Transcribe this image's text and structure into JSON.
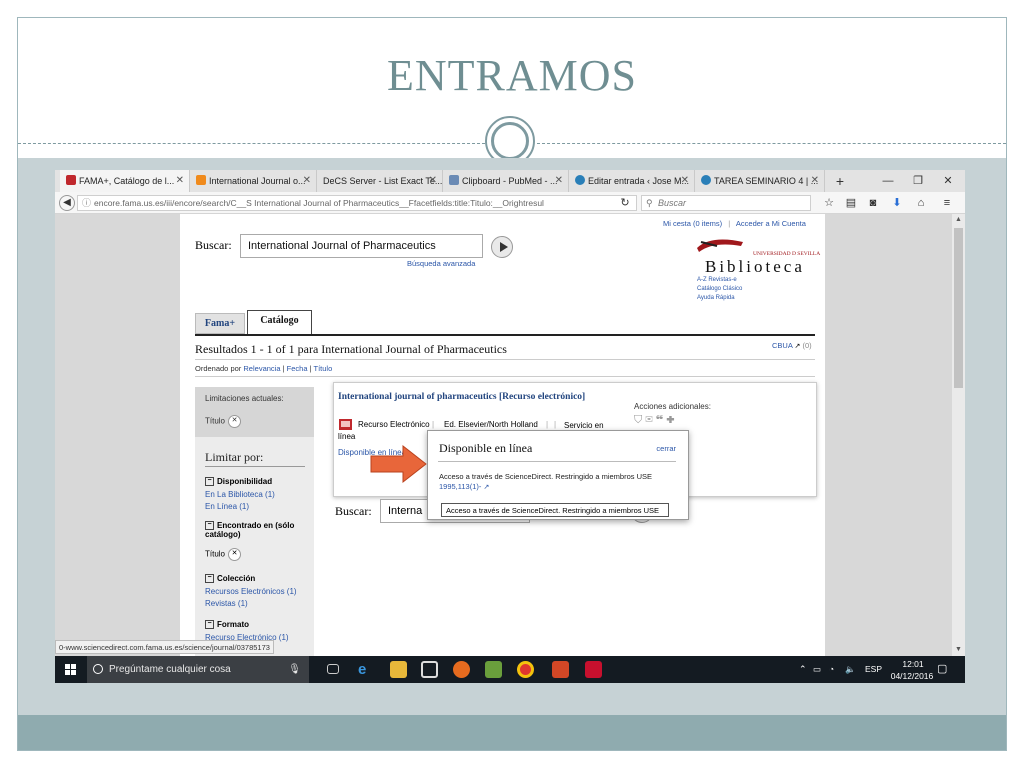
{
  "slide": {
    "title": "ENTRAMOS"
  },
  "browser": {
    "tabs": [
      {
        "label": "FAMA+, Catálogo de l...",
        "close": "✕"
      },
      {
        "label": "International Journal o...",
        "close": "✕"
      },
      {
        "label": "DeCS Server - List Exact Te...",
        "close": "✕"
      },
      {
        "label": "Clipboard - PubMed - ...",
        "close": "✕"
      },
      {
        "label": "Editar entrada ‹ Jose M...",
        "close": "✕"
      },
      {
        "label": "TAREA SEMINARIO 4 | ...",
        "close": "✕"
      }
    ],
    "new_tab": "+",
    "window": {
      "minimize": "—",
      "restore": "❐",
      "close": "✕"
    },
    "url": "encore.fama.us.es/iii/encore/search/C__S International Journal of Pharmaceutics__Ffacetfields:title:Titulo:__Orightresul",
    "search_placeholder": "Buscar",
    "status_url": "0-www.sciencedirect.com.fama.us.es/science/journal/03785173"
  },
  "page": {
    "account": {
      "cart": "Mi cesta (0 items)",
      "sep": "|",
      "login": "Acceder a Mi Cuenta"
    },
    "buscar_label": "Buscar:",
    "search_value": "International Journal of Pharmaceutics",
    "advanced": "Búsqueda avanzada",
    "logo": {
      "university": "UNIVERSIDAD D SEVILLA",
      "name": "Biblioteca",
      "links": [
        "A-Z Revistas-e",
        "Catálogo Clásico",
        "Ayuda Rápida"
      ]
    },
    "tabs": {
      "fama": "Fama+",
      "catalogo": "Catálogo"
    },
    "results_heading": "Resultados 1 - 1 of 1 para International Journal of Pharmaceutics",
    "cbua": "CBUA",
    "cbua_count": "(0)",
    "sort": {
      "label": "Ordenado por",
      "relevancia": "Relevancia",
      "fecha": "Fecha",
      "titulo": "Título",
      "sep": "|"
    },
    "facets": {
      "current_label": "Limitaciones actuales:",
      "current_chip": "Título",
      "limit_heading": "Limitar por:",
      "groups": [
        {
          "title": "Disponibilidad",
          "items": [
            "En La Biblioteca (1)",
            "En Línea (1)"
          ]
        },
        {
          "title": "Encontrado en (sólo catálogo)",
          "items": [
            "Título"
          ]
        },
        {
          "title": "Colección",
          "items": [
            "Recursos Electrónicos (1)",
            "Revistas (1)"
          ]
        },
        {
          "title": "Formato",
          "items": [
            "Recurso Electrónico (1)"
          ]
        }
      ]
    },
    "result": {
      "title": "International journal of pharmaceutics [Recurso electrónico]",
      "type": "Recurso Electrónico",
      "publisher": "Ed. Elsevier/North Holland",
      "service": "Servicio en línea",
      "available": "Disponible en línea",
      "actions_label": "Acciones adicionales:"
    },
    "popup": {
      "title": "Disponible en línea",
      "close": "cerrar",
      "text": "Acceso a través de ScienceDirect. Restringido a miembros USE",
      "link": "1995,113(1)-"
    },
    "tooltip": "Acceso a través de ScienceDirect. Restringido a miembros USE",
    "buscar_bottom_value": "Interna"
  },
  "taskbar": {
    "search_placeholder": "Pregúntame cualquier cosa",
    "lang": "ESP",
    "time": "12:01",
    "date": "04/12/2016"
  },
  "colors": {
    "title": "#6f8e92",
    "band": "#c6d2d5",
    "bottom_band": "#8fabaf",
    "link": "#2b56a8",
    "arrow": "#e8663a"
  }
}
